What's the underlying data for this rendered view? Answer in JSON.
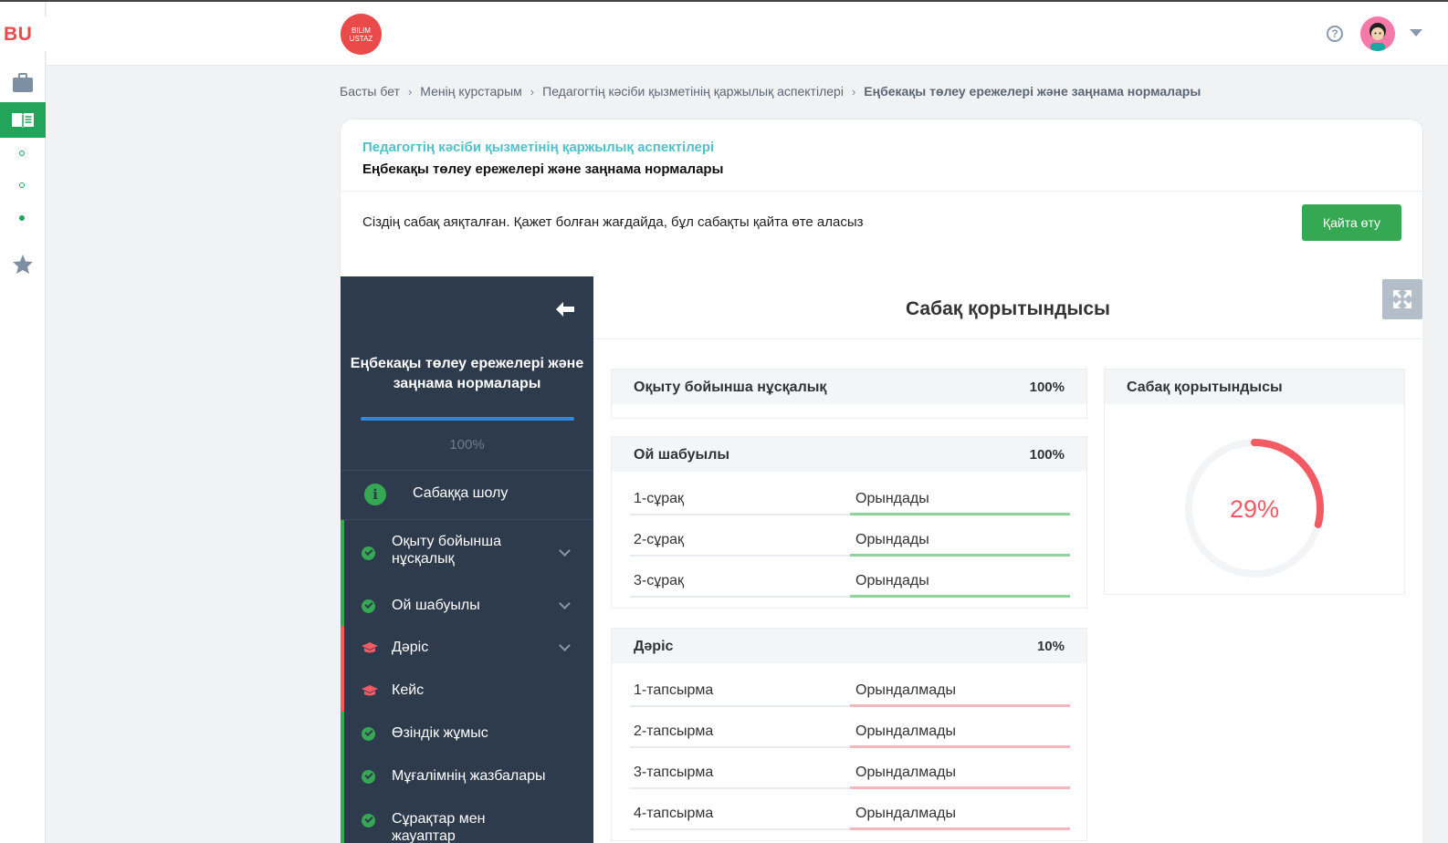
{
  "app": {
    "logo_text": "BU",
    "brand_text": "BILIM USTAZ",
    "avatar": "user-avatar"
  },
  "colors": {
    "accent_green": "#35a853",
    "accent_teal": "#4fc1c8",
    "danger_red": "#f25a64",
    "sidebar_bg": "#2d3b4d",
    "progress_blue": "#2b8ae0"
  },
  "breadcrumb": {
    "items": [
      "Басты бет",
      "Менің курстарым",
      "Педагогтің кәсіби қызметінің қаржылық аспектілері"
    ],
    "current": "Еңбекақы төлеу ережелері және заңнама нормалары"
  },
  "card": {
    "course": "Педагогтің кәсіби қызметінің қаржылық аспектілері",
    "lesson": "Еңбекақы төлеу ережелері және заңнама нормалары",
    "message": "Сіздің сабақ аяқталған. Қажет болған жағдайда, бұл сабақты қайта өте аласыз",
    "retry_label": "Қайта өту"
  },
  "sidebar": {
    "title": "Еңбекақы төлеу ережелері және заңнама нормалары",
    "progress": 1.0,
    "progress_label": "100%",
    "overview_label": "Сабаққа шолу",
    "items": [
      {
        "label": "Оқыту бойынша нұсқалық",
        "status": "done",
        "expandable": true
      },
      {
        "label": "Ой шабуылы",
        "status": "done",
        "expandable": true
      },
      {
        "label": "Дәріс",
        "status": "pending",
        "expandable": true
      },
      {
        "label": "Кейс",
        "status": "pending",
        "expandable": false
      },
      {
        "label": "Өзіндік жұмыс",
        "status": "done",
        "expandable": false
      },
      {
        "label": "Мұғалімнің жазбалары",
        "status": "done",
        "expandable": false
      },
      {
        "label": "Сұрақтар мен жауаптар",
        "status": "done",
        "expandable": false
      }
    ]
  },
  "main": {
    "title": "Сабақ қорытындысы",
    "blocks": [
      {
        "name": "Оқыту бойынша нұсқалық",
        "percent": "100%",
        "rows": []
      },
      {
        "name": "Ой шабуылы",
        "percent": "100%",
        "rows": [
          {
            "item": "1-сұрақ",
            "status": "Орындады",
            "done": true
          },
          {
            "item": "2-сұрақ",
            "status": "Орындады",
            "done": true
          },
          {
            "item": "3-сұрақ",
            "status": "Орындады",
            "done": true
          }
        ]
      },
      {
        "name": "Дәріс",
        "percent": "10%",
        "rows": [
          {
            "item": "1-тапсырма",
            "status": "Орындалмады",
            "done": false
          },
          {
            "item": "2-тапсырма",
            "status": "Орындалмады",
            "done": false
          },
          {
            "item": "3-тапсырма",
            "status": "Орындалмады",
            "done": false
          },
          {
            "item": "4-тапсырма",
            "status": "Орындалмады",
            "done": false
          }
        ]
      }
    ],
    "summary": {
      "title": "Сабақ қорытындысы",
      "percent_label": "29%",
      "percent_value": 29
    }
  }
}
